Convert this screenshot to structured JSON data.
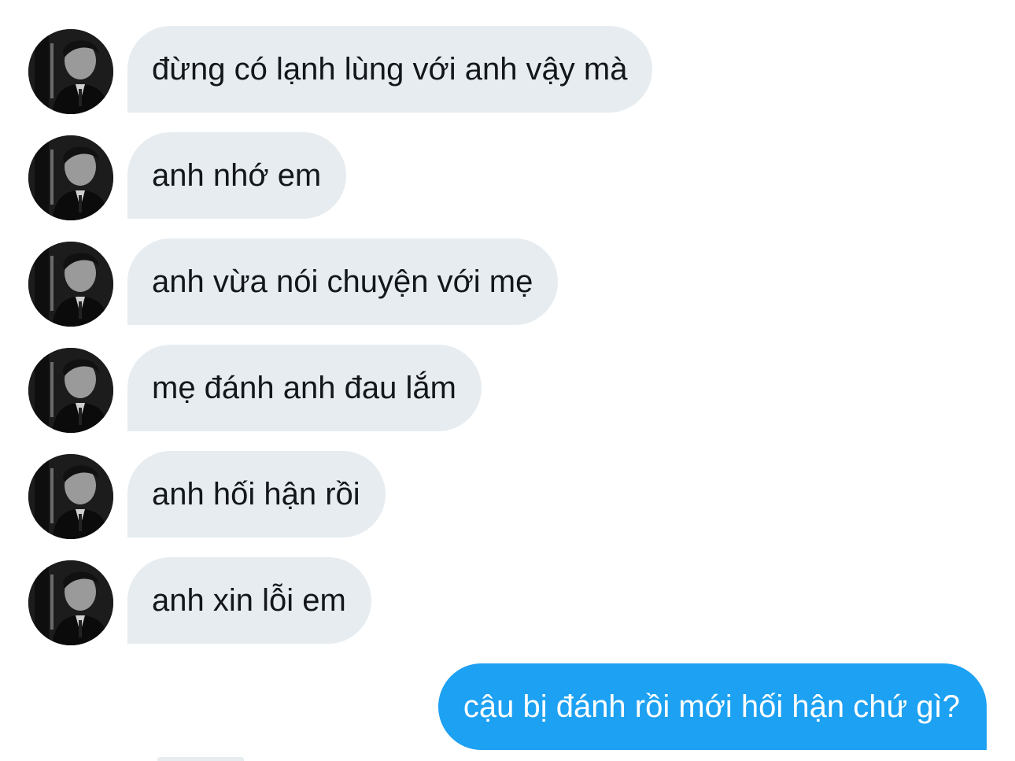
{
  "conversation": {
    "incoming_messages": [
      {
        "text": "đừng có lạnh lùng với anh vậy mà"
      },
      {
        "text": "anh nhớ em"
      },
      {
        "text": "anh vừa nói chuyện với mẹ"
      },
      {
        "text": "mẹ đánh anh đau lắm"
      },
      {
        "text": "anh hối hận rồi"
      },
      {
        "text": "anh xin lỗi em"
      }
    ],
    "outgoing_messages": [
      {
        "text": "cậu bị đánh rồi mới hối hận chứ gì?"
      }
    ]
  },
  "colors": {
    "incoming_bubble": "#e6ecf0",
    "incoming_text": "#14171a",
    "outgoing_bubble": "#1da1f2",
    "outgoing_text": "#ffffff",
    "background": "#ffffff"
  },
  "icons": {
    "avatar": "avatar-photo-icon"
  }
}
